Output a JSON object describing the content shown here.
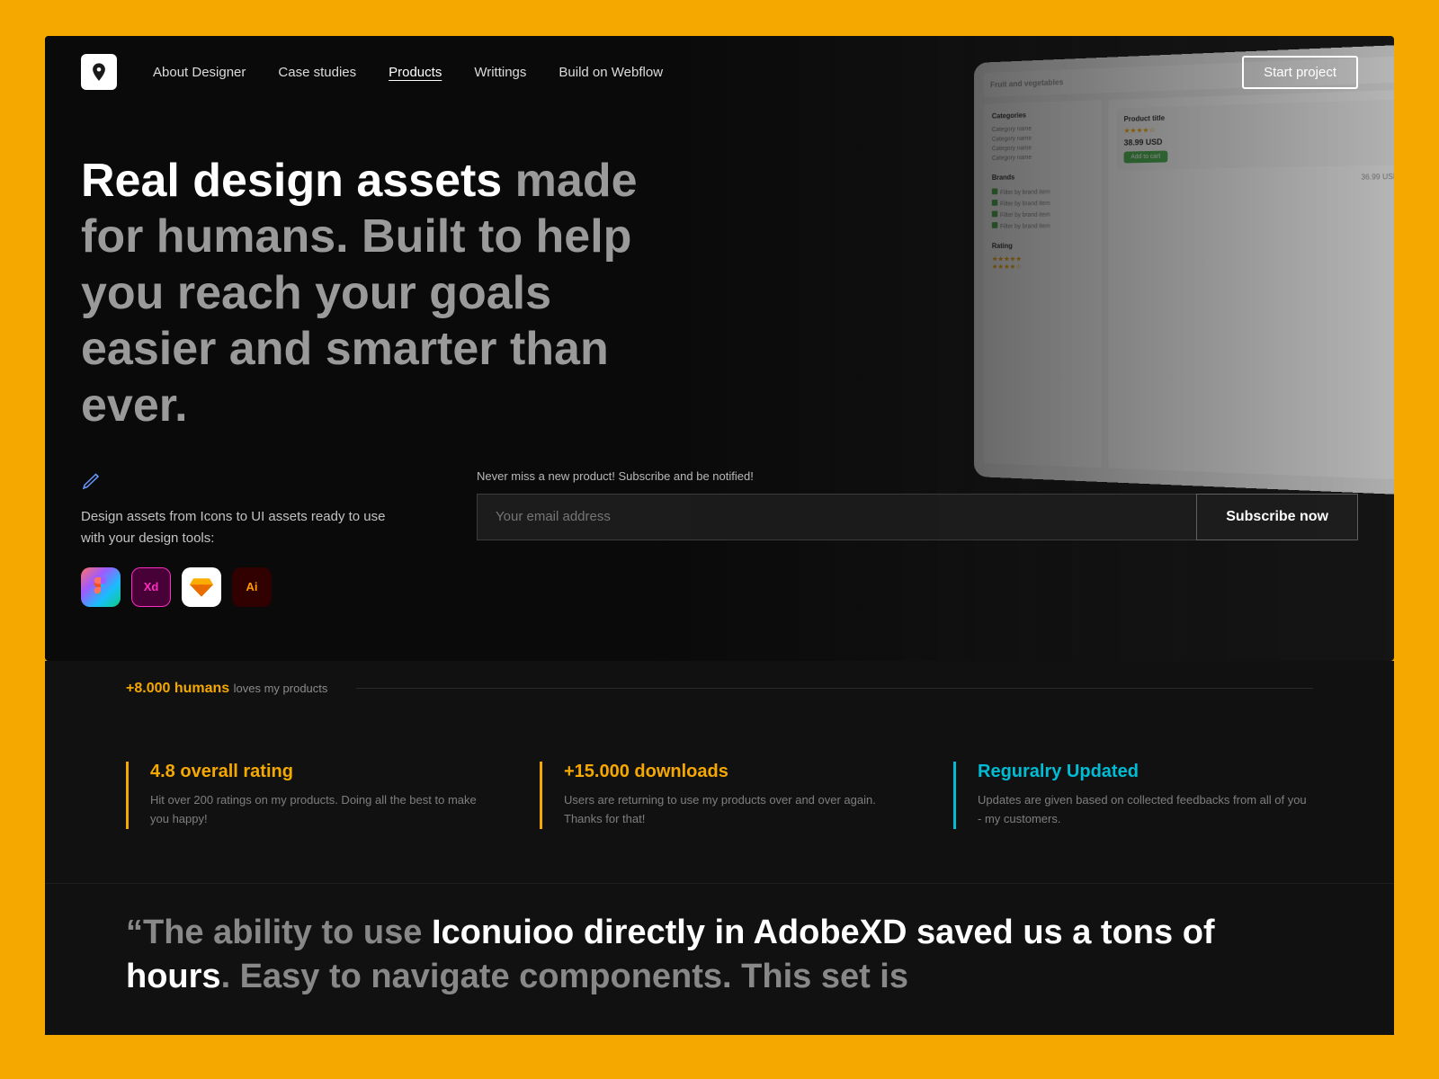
{
  "page": {
    "background_color": "#F5A800"
  },
  "nav": {
    "logo_alt": "Designer logo",
    "links": [
      {
        "label": "About Designer",
        "active": false
      },
      {
        "label": "Case studies",
        "active": false
      },
      {
        "label": "Products",
        "active": true
      },
      {
        "label": "Writtings",
        "active": false
      },
      {
        "label": "Build on Webflow",
        "active": false
      }
    ],
    "cta_label": "Start project"
  },
  "hero": {
    "headline_bold": "Real design assets",
    "headline_rest": " made for humans. Built to help you reach your goals easier and smarter than ever.",
    "sub_text": "Design assets from Icons to UI assets ready to use with your design tools:",
    "tools": [
      {
        "name": "Figma",
        "abbr": "F"
      },
      {
        "name": "Adobe XD",
        "abbr": "Xd"
      },
      {
        "name": "Sketch",
        "abbr": "S"
      },
      {
        "name": "Illustrator",
        "abbr": "Ai"
      }
    ],
    "subscribe_label": "Never miss a new product! Subscribe and be notified!",
    "subscribe_placeholder": "Your email address",
    "subscribe_btn": "Subscribe now"
  },
  "stats_bar": {
    "highlight": "+8.000 humans",
    "text": "loves my products"
  },
  "stats": [
    {
      "title": "4.8 overall rating",
      "color": "yellow",
      "desc": "Hit over 200 ratings on my products. Doing all the best to make you happy!"
    },
    {
      "title": "+15.000 downloads",
      "color": "yellow",
      "desc": "Users are returning to use my products over and over again. Thanks for that!"
    },
    {
      "title": "Reguralry Updated",
      "color": "teal",
      "desc": "Updates are given based on collected feedbacks from all of you - my customers."
    }
  ],
  "testimonial": {
    "text_pre": "“The ability to use ",
    "text_highlight": "Iconuioo directly in AdobeXD saved us a tons of hours",
    "text_post": ". Easy to navigate components. This set is"
  }
}
